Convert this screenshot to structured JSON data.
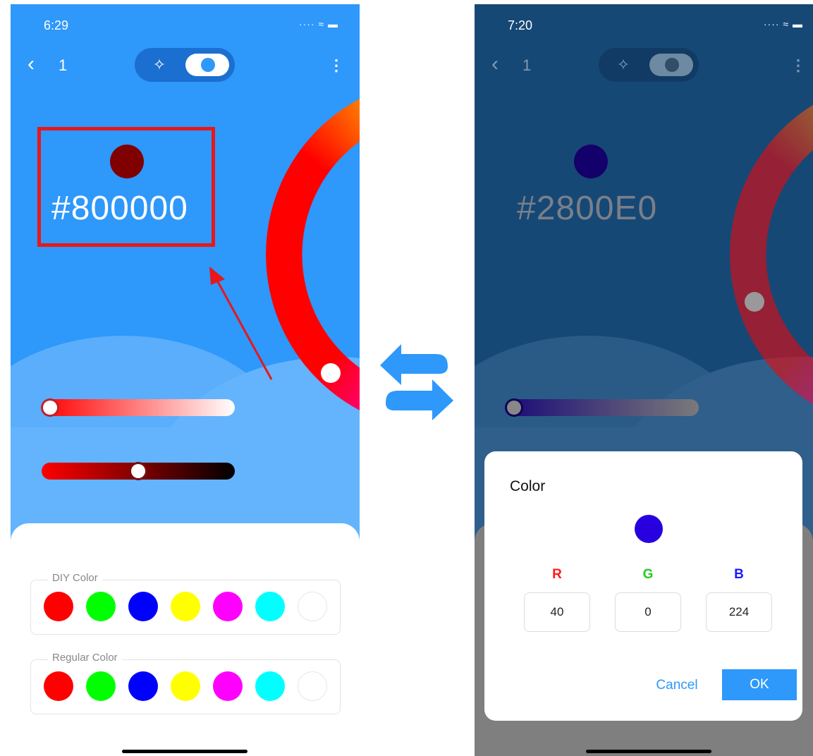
{
  "left": {
    "status_time": "6:29",
    "status_icons": "···· ≈ ▬",
    "back_icon": "‹",
    "page_number": "1",
    "toggle_left_icon": "✧",
    "more_icon": "⋮",
    "current_hex": "#800000",
    "current_color": "#800000",
    "diy_title": "DIY Color",
    "regular_title": "Regular Color",
    "palette": [
      "#ff0000",
      "#00ff00",
      "#0000ff",
      "#ffff00",
      "#ff00ff",
      "#00ffff",
      "#ffffff"
    ],
    "saturation_level": 0.05,
    "brightness_level": 0.5
  },
  "swap_icon": "swap-arrows-icon",
  "right": {
    "status_time": "7:20",
    "status_icons": "···· ≈ ▬",
    "back_icon": "‹",
    "page_number": "1",
    "toggle_left_icon": "✧",
    "more_icon": "⋮",
    "current_hex": "#2800E0",
    "current_color": "#1e0080",
    "dialog": {
      "title": "Color",
      "preview_color": "#2800e0",
      "r_label": "R",
      "g_label": "G",
      "b_label": "B",
      "r_value": "40",
      "g_value": "0",
      "b_value": "224",
      "cancel_label": "Cancel",
      "ok_label": "OK"
    }
  },
  "colors": {
    "accent": "#2e98fb",
    "highlight_box": "#e8171b",
    "r_label": "#ff1a1a",
    "g_label": "#22cc22",
    "b_label": "#1a1aff"
  }
}
